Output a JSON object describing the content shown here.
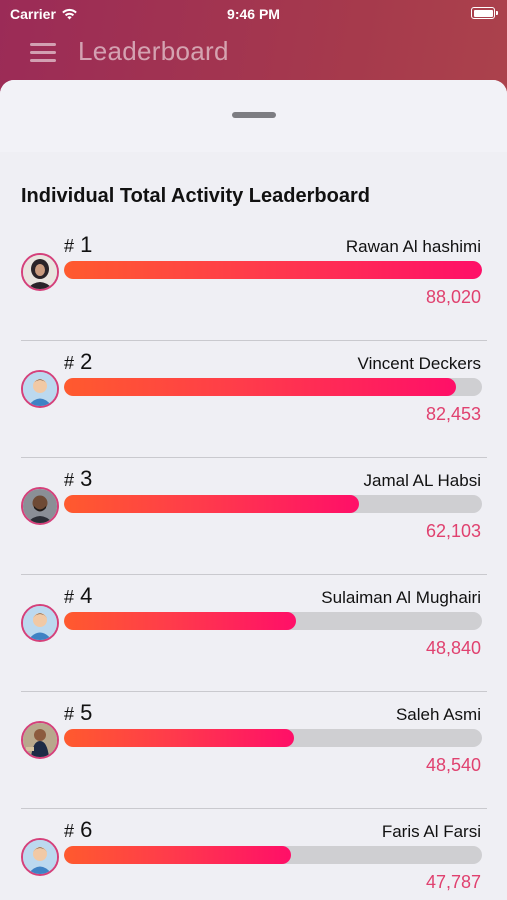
{
  "status_bar": {
    "carrier": "Carrier",
    "time": "9:46 PM"
  },
  "nav": {
    "title": "Leaderboard"
  },
  "board": {
    "title": "Individual Total Activity Leaderboard",
    "entries": [
      {
        "hash": "#",
        "rank": "1",
        "name": "Rawan Al hashimi",
        "score": "88,020",
        "progress": 1.0
      },
      {
        "hash": "#",
        "rank": "2",
        "name": "Vincent Deckers",
        "score": "82,453",
        "progress": 0.937
      },
      {
        "hash": "#",
        "rank": "3",
        "name": "Jamal AL Habsi",
        "score": "62,103",
        "progress": 0.705
      },
      {
        "hash": "#",
        "rank": "4",
        "name": "Sulaiman Al Mughairi",
        "score": "48,840",
        "progress": 0.555
      },
      {
        "hash": "#",
        "rank": "5",
        "name": "Saleh Asmi",
        "score": "48,540",
        "progress": 0.551
      },
      {
        "hash": "#",
        "rank": "6",
        "name": "Faris Al Farsi",
        "score": "47,787",
        "progress": 0.543
      }
    ]
  },
  "colors": {
    "accent": "#e0416f",
    "bar_start": "#ff5a2e",
    "bar_end": "#ff0f68",
    "track": "#cfcfd2"
  },
  "icons": {
    "menu": "hamburger-menu-icon",
    "wifi": "wifi-icon",
    "battery": "battery-icon"
  }
}
